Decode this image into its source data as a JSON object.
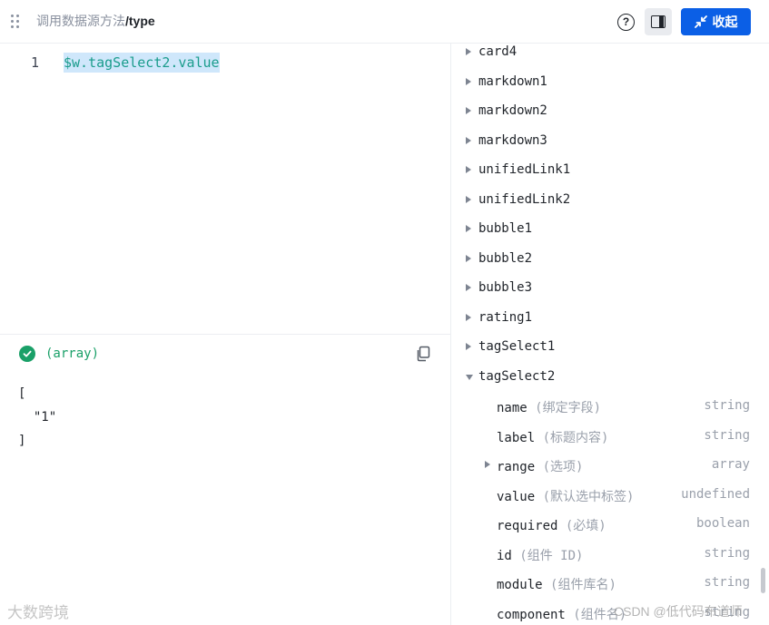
{
  "header": {
    "breadcrumb_parent": "调用数据源方法",
    "breadcrumb_sep": "/",
    "breadcrumb_current": "type",
    "help_glyph": "?",
    "collapse_label": "收起",
    "accent_color": "#0b5fe6"
  },
  "editor": {
    "line_number": "1",
    "code": "$w.tagSelect2.value"
  },
  "result": {
    "status_icon": "check-circle-icon",
    "type_label": "(array)",
    "status_color": "#1aa068",
    "output_lines": [
      "[",
      "  \"1\"",
      "]"
    ]
  },
  "tree": {
    "items": [
      {
        "key": "card4",
        "expanded": false
      },
      {
        "key": "markdown1",
        "expanded": false
      },
      {
        "key": "markdown2",
        "expanded": false
      },
      {
        "key": "markdown3",
        "expanded": false
      },
      {
        "key": "unifiedLink1",
        "expanded": false
      },
      {
        "key": "unifiedLink2",
        "expanded": false
      },
      {
        "key": "bubble1",
        "expanded": false
      },
      {
        "key": "bubble2",
        "expanded": false
      },
      {
        "key": "bubble3",
        "expanded": false
      },
      {
        "key": "rating1",
        "expanded": false
      },
      {
        "key": "tagSelect1",
        "expanded": false
      },
      {
        "key": "tagSelect2",
        "expanded": true
      }
    ],
    "children": [
      {
        "key": "name",
        "desc": "(绑定字段)",
        "type": "string",
        "expandable": false
      },
      {
        "key": "label",
        "desc": "(标题内容)",
        "type": "string",
        "expandable": false
      },
      {
        "key": "range",
        "desc": "(选项)",
        "type": "array",
        "expandable": true
      },
      {
        "key": "value",
        "desc": "(默认选中标签)",
        "type": "undefined",
        "expandable": false
      },
      {
        "key": "required",
        "desc": "(必填)",
        "type": "boolean",
        "expandable": false
      },
      {
        "key": "id",
        "desc": "(组件 ID)",
        "type": "string",
        "expandable": false
      },
      {
        "key": "module",
        "desc": "(组件库名)",
        "type": "string",
        "expandable": false
      },
      {
        "key": "component",
        "desc": "(组件名)",
        "type": "string",
        "expandable": false
      }
    ]
  },
  "watermark": {
    "left_text": "大数跨境",
    "right_text": "CSDN @低代码布道师"
  }
}
